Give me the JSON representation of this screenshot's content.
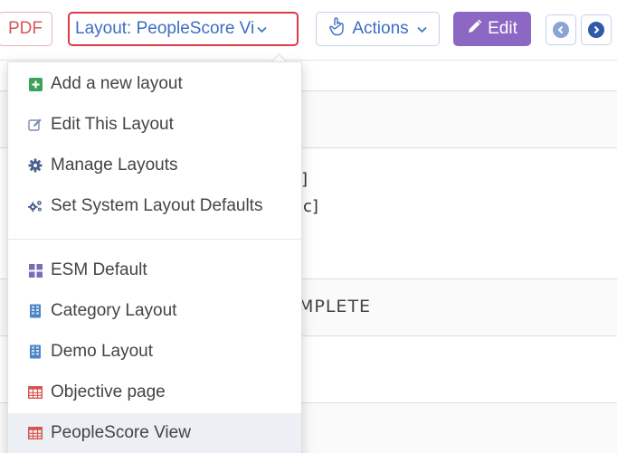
{
  "toolbar": {
    "pdf_label": "PDF",
    "layout_label": "Layout: PeopleScore Vi",
    "actions_label": "Actions",
    "edit_label": "Edit"
  },
  "background": {
    "bracket_1": "]",
    "bracket_2": "[c]",
    "status_fragment": "MPLETE"
  },
  "menu": {
    "actions": [
      {
        "label": "Add a new layout",
        "icon": "plus-square-icon"
      },
      {
        "label": "Edit This Layout",
        "icon": "edit-icon"
      },
      {
        "label": "Manage Layouts",
        "icon": "gear-icon"
      },
      {
        "label": "Set System Layout Defaults",
        "icon": "gears-icon"
      }
    ],
    "layouts": [
      {
        "label": "ESM Default",
        "icon": "grid-icon"
      },
      {
        "label": "Category Layout",
        "icon": "building-icon"
      },
      {
        "label": "Demo Layout",
        "icon": "building-icon"
      },
      {
        "label": "Objective page",
        "icon": "table-icon"
      },
      {
        "label": "PeopleScore View",
        "icon": "table-icon",
        "selected": true
      }
    ]
  },
  "colors": {
    "accent_blue": "#3d6dc3",
    "edit_purple": "#8d67c4",
    "pdf_red": "#d8545a",
    "highlight_red": "#e0394a",
    "green_icon": "#3aa35a",
    "table_red": "#d9534f"
  }
}
